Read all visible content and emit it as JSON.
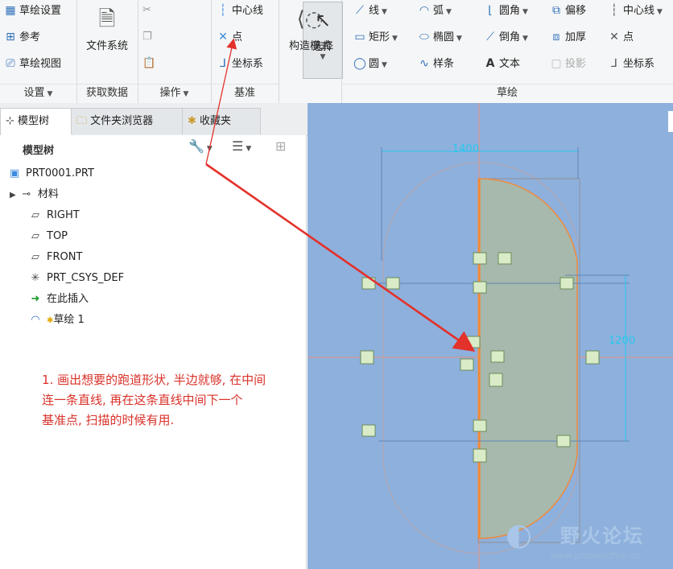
{
  "ribbon": {
    "setup": {
      "title": "设置",
      "items": [
        "草绘设置",
        "参考",
        "草绘视图"
      ]
    },
    "get_data": {
      "title": "获取数据",
      "file_system": "文件系统"
    },
    "operations": {
      "title": "操作",
      "select": "选择"
    },
    "datum": {
      "title": "基准",
      "items": [
        "中心线",
        "点",
        "坐标系"
      ]
    },
    "construction": {
      "label": "构造模式"
    },
    "sketch": {
      "title": "草绘",
      "col1": [
        "线",
        "矩形",
        "圆"
      ],
      "col2": [
        "弧",
        "椭圆",
        "样条"
      ],
      "col3": [
        "圆角",
        "倒角",
        "文本"
      ],
      "col4": [
        "偏移",
        "加厚",
        "投影"
      ],
      "col5": [
        "中心线",
        "点",
        "坐标系"
      ]
    }
  },
  "tabs": [
    "模型树",
    "文件夹浏览器",
    "收藏夹"
  ],
  "model_tree": {
    "title": "模型树",
    "items": [
      "PRT0001.PRT",
      "材料",
      "RIGHT",
      "TOP",
      "FRONT",
      "PRT_CSYS_DEF",
      "在此插入",
      "草绘 1"
    ]
  },
  "annotation": {
    "lines": [
      "1. 画出想要的跑道形状, 半边就够, 在中间",
      "连一条直线, 再在这条直线中间下一个",
      "基准点, 扫描的时候有用."
    ]
  },
  "canvas": {
    "dim_width": "1400",
    "dim_height": "1200"
  },
  "watermark": {
    "title": "野火论坛",
    "url": "www.proewildfire.cn"
  },
  "colors": {
    "canvas_bg": "#8eb0dc",
    "annotation": "#d9322a",
    "dimension": "#28c8f0",
    "sketch_fill": "#a7b9ac",
    "arrow": "#e3312b"
  }
}
